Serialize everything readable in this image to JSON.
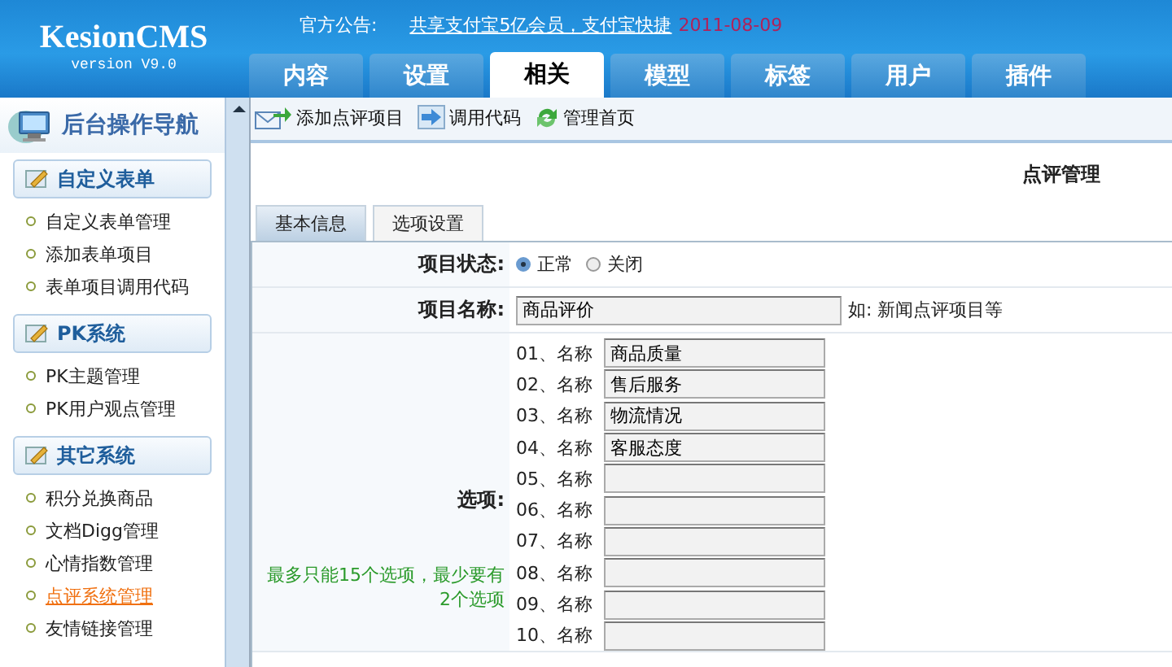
{
  "header": {
    "logo": "KesionCMS",
    "version": "version V9.0",
    "notice_label": "官方公告:",
    "notice_link": "共享支付宝5亿会员，支付宝快捷",
    "notice_date": "2011-08-09"
  },
  "tabs": [
    {
      "label": "内容",
      "selected": false
    },
    {
      "label": "设置",
      "selected": false
    },
    {
      "label": "相关",
      "selected": true
    },
    {
      "label": "模型",
      "selected": false
    },
    {
      "label": "标签",
      "selected": false
    },
    {
      "label": "用户",
      "selected": false
    },
    {
      "label": "插件",
      "selected": false
    }
  ],
  "toolbar": [
    {
      "label": "添加点评项目"
    },
    {
      "label": "调用代码"
    },
    {
      "label": "管理首页"
    }
  ],
  "sidebar": {
    "title": "后台操作导航",
    "sections": [
      {
        "title": "自定义表单",
        "items": [
          {
            "label": "自定义表单管理",
            "selected": false
          },
          {
            "label": "添加表单项目",
            "selected": false
          },
          {
            "label": "表单项目调用代码",
            "selected": false
          }
        ]
      },
      {
        "title": "PK系统",
        "items": [
          {
            "label": "PK主题管理",
            "selected": false
          },
          {
            "label": "PK用户观点管理",
            "selected": false
          }
        ]
      },
      {
        "title": "其它系统",
        "items": [
          {
            "label": "积分兑换商品",
            "selected": false
          },
          {
            "label": "文档Digg管理",
            "selected": false
          },
          {
            "label": "心情指数管理",
            "selected": false
          },
          {
            "label": "点评系统管理",
            "selected": true
          },
          {
            "label": "友情链接管理",
            "selected": false
          }
        ]
      }
    ]
  },
  "page_title": "点评管理",
  "form_tabs": [
    {
      "label": "基本信息",
      "selected": true
    },
    {
      "label": "选项设置",
      "selected": false
    }
  ],
  "form": {
    "status": {
      "label": "项目状态:",
      "options": [
        {
          "label": "正常",
          "selected": true
        },
        {
          "label": "关闭",
          "selected": false
        }
      ]
    },
    "name": {
      "label": "项目名称:",
      "value": "商品评价",
      "hint": "如: 新闻点评项目等"
    },
    "options": {
      "label": "选项:",
      "help": "最多只能15个选项，最少要有2个选项",
      "items": [
        {
          "number": "01、名称",
          "value": "商品质量"
        },
        {
          "number": "02、名称",
          "value": "售后服务"
        },
        {
          "number": "03、名称",
          "value": "物流情况"
        },
        {
          "number": "04、名称",
          "value": "客服态度"
        },
        {
          "number": "05、名称"
        },
        {
          "number": "06、名称"
        },
        {
          "number": "07、名称"
        },
        {
          "number": "08、名称"
        },
        {
          "number": "09、名称"
        },
        {
          "number": "10、名称"
        }
      ]
    }
  }
}
